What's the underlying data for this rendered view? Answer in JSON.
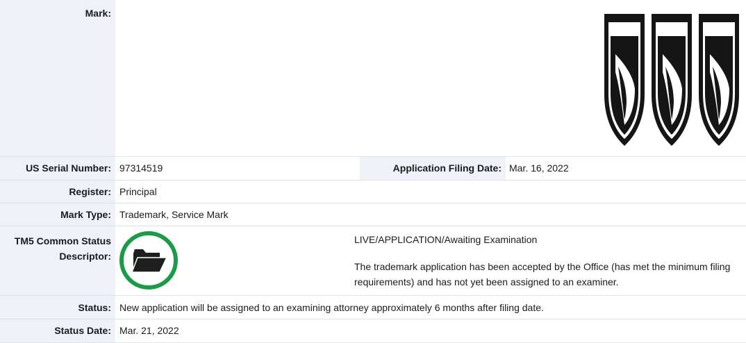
{
  "mark": {
    "label": "Mark:",
    "logo_icon": "three-bullet-shield-mark-icon"
  },
  "serial": {
    "label": "US Serial Number:",
    "value": "97314519"
  },
  "filing": {
    "label": "Application Filing Date:",
    "value": "Mar. 16, 2022"
  },
  "register": {
    "label": "Register:",
    "value": "Principal"
  },
  "mark_type": {
    "label": "Mark Type:",
    "value": "Trademark, Service Mark"
  },
  "tm5": {
    "label_line1": "TM5 Common Status",
    "label_line2": "Descriptor:",
    "icon": "open-folder-icon",
    "ring_color": "#1a9b48",
    "title": "LIVE/APPLICATION/Awaiting Examination",
    "description": "The trademark application has been accepted by the Office (has met the minimum filing requirements) and has not yet been assigned to an examiner."
  },
  "status": {
    "label": "Status:",
    "value": "New application will be assigned to an examining attorney approximately 6 months after filing date."
  },
  "status_date": {
    "label": "Status Date:",
    "value": "Mar. 21, 2022"
  }
}
